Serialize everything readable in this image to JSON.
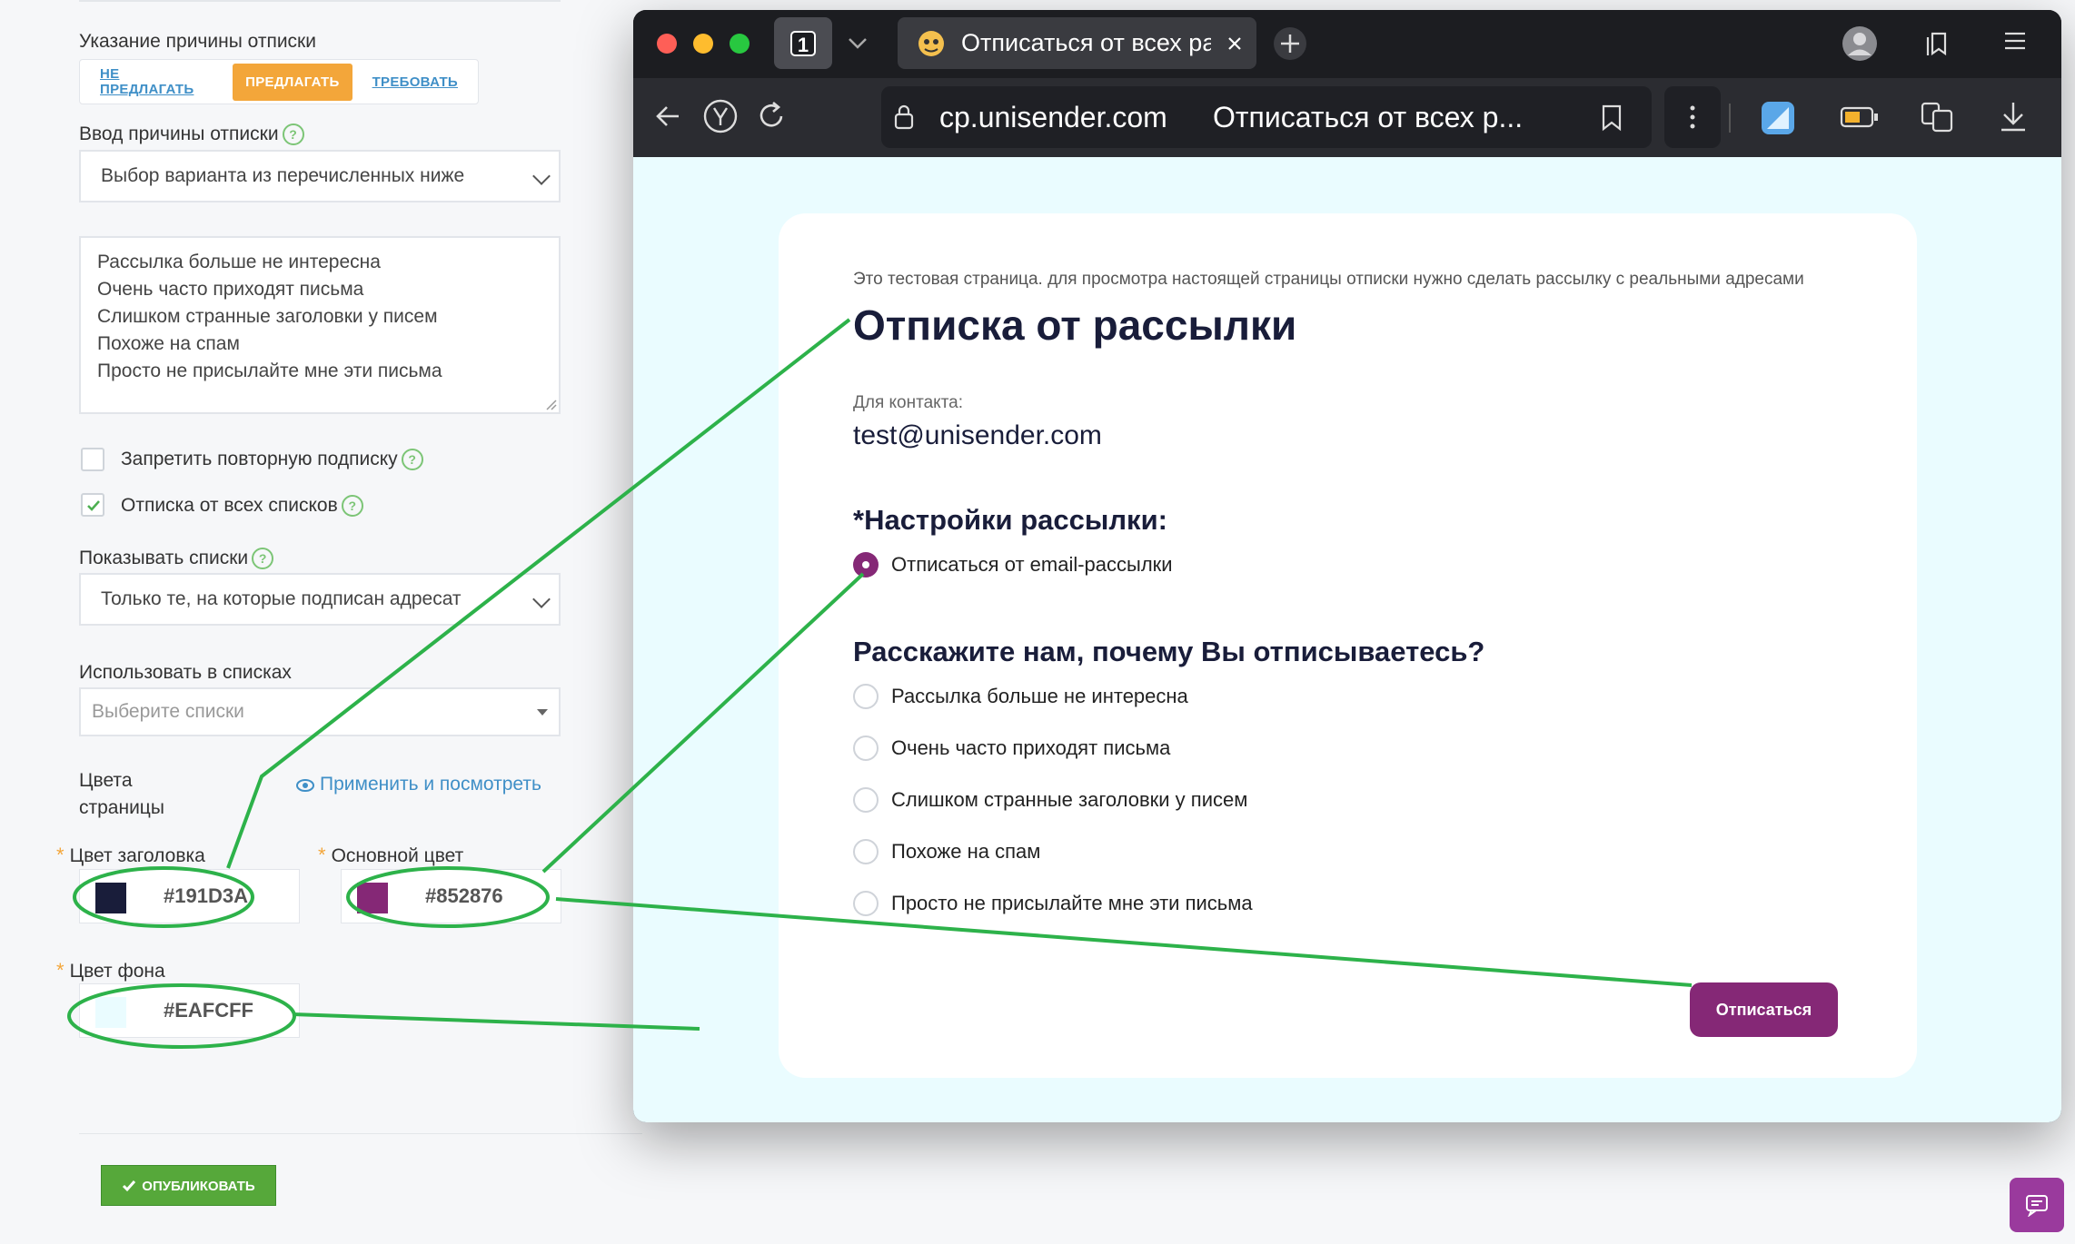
{
  "settings": {
    "reason_label": "Указание причины отписки",
    "reason_options": [
      "НЕ ПРЕДЛАГАТЬ",
      "ПРЕДЛАГАТЬ",
      "ТРЕБОВАТЬ"
    ],
    "reason_selected": "ПРЕДЛАГАТЬ",
    "input_reason_label": "Ввод причины отписки",
    "input_reason_value": "Выбор варианта из перечисленных ниже",
    "reasons_text": [
      "Рассылка больше не интересна",
      "Очень часто приходят письма",
      "Слишком странные заголовки у писем",
      "Похоже на спам",
      "Просто не присылайте мне эти письма"
    ],
    "forbid_resubscribe_label": "Запретить повторную подписку",
    "forbid_resubscribe_checked": false,
    "unsub_all_label": "Отписка от всех списков",
    "unsub_all_checked": true,
    "show_lists_label": "Показывать списки",
    "show_lists_value": "Только те, на которые подписан адресат",
    "use_in_lists_label": "Использовать в списках",
    "use_in_lists_placeholder": "Выберите списки",
    "page_colors_label_1": "Цвета",
    "page_colors_label_2": "страницы",
    "apply_preview_link": "Применить и посмотреть",
    "title_color_label": "Цвет заголовка",
    "title_color_value": "#191D3A",
    "main_color_label": "Основной цвет",
    "main_color_value": "#852876",
    "bg_color_label": "Цвет фона",
    "bg_color_value": "#EAFCFF",
    "publish_label": "ОПУБЛИКОВАТЬ",
    "required_mark": "*",
    "help_mark": "?"
  },
  "browser": {
    "tab_count": "1",
    "tab_title": "Отписаться от всех рассылок",
    "address_host": "cp.unisender.com",
    "address_title": "Отписаться от всех р..."
  },
  "page": {
    "test_note": "Это тестовая страница. для просмотра настоящей страницы отписки нужно сделать рассылку с реальными адресами",
    "title": "Отписка от рассылки",
    "contact_label": "Для контакта:",
    "contact_email": "test@unisender.com",
    "settings_heading": "*Настройки рассылки:",
    "unsub_option": "Отписаться от email-рассылки",
    "why_heading": "Расскажите нам, почему Вы отписываетесь?",
    "reasons": [
      "Рассылка больше не интересна",
      "Очень часто приходят письма",
      "Слишком странные заголовки у писем",
      "Похоже на спам",
      "Просто не присылайте мне эти письма"
    ],
    "unsubscribe_button": "Отписаться"
  },
  "colors": {
    "title": "#191d3a",
    "accent": "#852876",
    "background": "#eafcff",
    "annotation": "#2db24a",
    "segment_active": "#f3a63a",
    "publish": "#56a83a"
  },
  "icons": [
    "help-icon",
    "chevron-down-icon",
    "check-icon",
    "eye-icon",
    "back-icon",
    "yandex-icon",
    "reload-icon",
    "lock-icon",
    "bookmark-icon",
    "menu-dots-icon",
    "downloads-icon",
    "chat-icon",
    "new-tab-icon",
    "close-icon",
    "profile-icon",
    "hamburger-icon",
    "tab-favicon"
  ]
}
